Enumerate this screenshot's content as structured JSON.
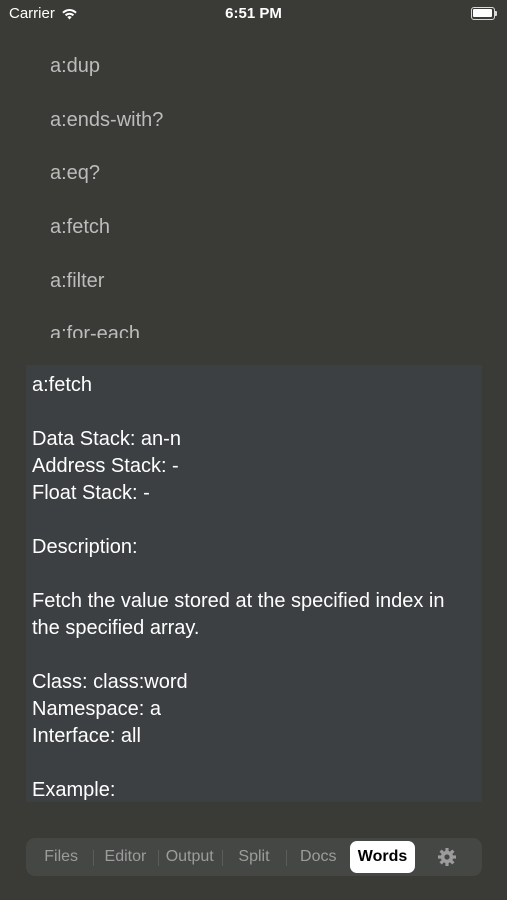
{
  "status_bar": {
    "carrier": "Carrier",
    "time": "6:51 PM"
  },
  "word_list": [
    "a:dup",
    "a:ends-with?",
    "a:eq?",
    "a:fetch",
    "a:filter",
    "a:for-each"
  ],
  "doc": {
    "lines": [
      "a:fetch",
      "",
      "Data Stack: an-n",
      "Address Stack: -",
      "Float Stack: -",
      "",
      "Description:",
      "",
      "Fetch the value stored at the specified index in",
      "the specified array.",
      "",
      "Class: class:word",
      "Namespace: a",
      "Interface: all",
      "",
      "Example:"
    ]
  },
  "tabs": [
    {
      "label": "Files",
      "active": false
    },
    {
      "label": "Editor",
      "active": false
    },
    {
      "label": "Output",
      "active": false
    },
    {
      "label": "Split",
      "active": false
    },
    {
      "label": "Docs",
      "active": false
    },
    {
      "label": "Words",
      "active": true
    }
  ],
  "settings_icon": "gear-icon"
}
